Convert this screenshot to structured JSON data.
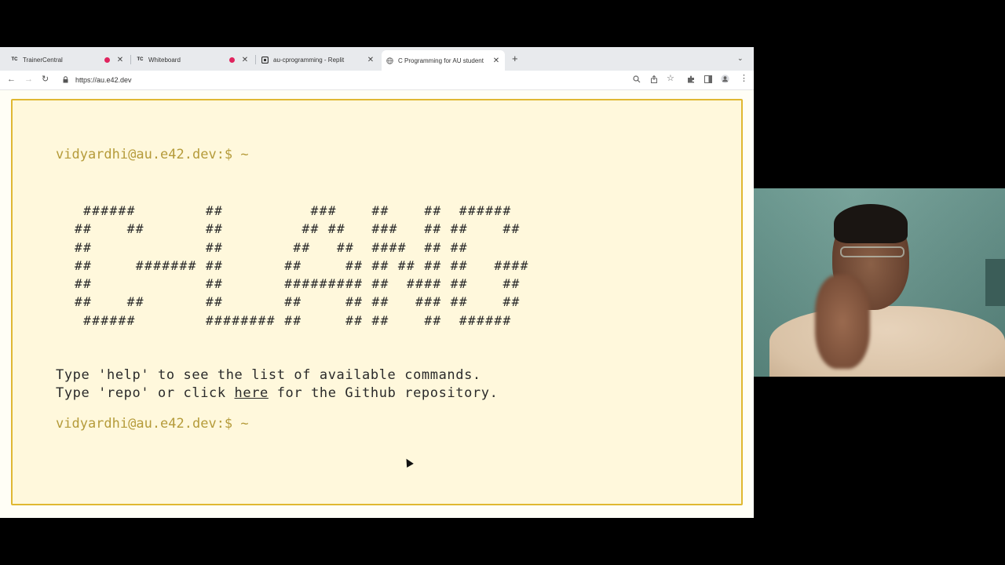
{
  "browser": {
    "tabs": [
      {
        "favicon": "TC",
        "title": "TrainerCentral",
        "recording": true
      },
      {
        "favicon": "TC",
        "title": "Whiteboard",
        "recording": true
      },
      {
        "favicon": "replit-icon",
        "title": "au-cprogramming - Replit",
        "recording": false
      },
      {
        "favicon": "globe-icon",
        "title": "C Programming for AU student",
        "recording": false,
        "active": true
      }
    ],
    "url": "https://au.e42.dev"
  },
  "terminal": {
    "prompt_text": "vidyardhi@au.e42.dev:$ ~",
    "banner_lines": [
      " ######        ##          ###    ##    ##  ######",
      "##    ##       ##         ## ##   ###   ## ##    ##",
      "##             ##        ##   ##  ####  ## ##",
      "##     ####### ##       ##     ## ## ## ## ##   ####",
      "##             ##       ######### ##  #### ##    ##",
      "##    ##       ##       ##     ## ##   ### ##    ##",
      " ######        ######## ##     ## ##    ##  ######"
    ],
    "help_line": "Type 'help' to see the list of available commands.",
    "repo_line_before": "Type 'repo' or click ",
    "repo_link": "here",
    "repo_line_after": " for the Github repository.",
    "accent_color": "#e0b832",
    "prompt_color": "#b59b3a"
  }
}
